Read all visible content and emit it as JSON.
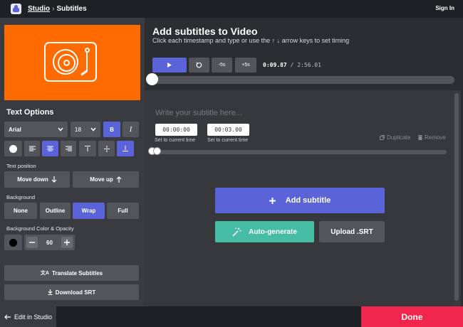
{
  "topbar": {
    "studio_link": "Studio",
    "separator": "›",
    "page": "Subtitles",
    "sign_in": "Sign In"
  },
  "left": {
    "text_options_title": "Text Options",
    "font": {
      "value": "Arial",
      "options": [
        "Arial"
      ]
    },
    "font_size": {
      "value": "18"
    },
    "bold_label": "B",
    "italic_label": "I",
    "text_position_label": "Text position",
    "move_down": "Move down",
    "move_up": "Move up",
    "background_label": "Background",
    "background_options": [
      "None",
      "Outline",
      "Wrap",
      "Full"
    ],
    "background_selected": "Wrap",
    "bg_color_label": "Background Color & Opacity",
    "opacity_value": "60",
    "translate": "Translate Subtitles",
    "download": "Download SRT"
  },
  "right": {
    "title": "Add subtitles to Video",
    "subtitle": "Click each timestamp and type or use the ↑ ↓ arrow keys to set timing",
    "player": {
      "back5": "-5s",
      "fwd5": "+5s",
      "current_time": "0:09.87",
      "time_separator": "/",
      "total_time": "2:56.01"
    },
    "editor": {
      "placeholder": "Write your subtitle here...",
      "start": "00:00:00",
      "end": "00:03.00",
      "set_current": "Set to current time",
      "duplicate": "Duplicate",
      "remove": "Remove"
    },
    "add_subtitle": "Add subtitle",
    "auto_generate": "Auto-generate",
    "upload_srt": "Upload .SRT"
  },
  "bottom": {
    "edit_in_studio": "Edit in Studio",
    "done": "Done"
  },
  "colors": {
    "accent": "#5b63d8",
    "done": "#f0264e",
    "auto_generate": "#45bca4",
    "thumbnail": "#ff6b00"
  }
}
